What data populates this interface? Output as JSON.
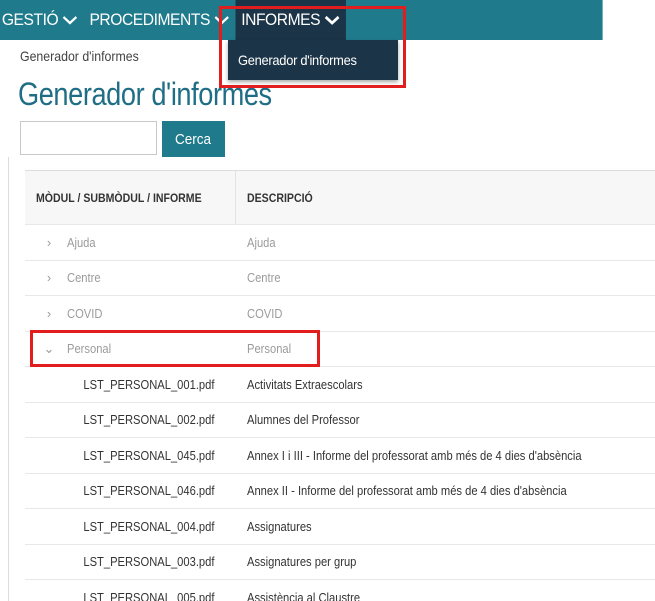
{
  "nav": {
    "items": [
      {
        "label": "GESTIÓ"
      },
      {
        "label": "PROCEDIMENTS"
      },
      {
        "label": "INFORMES"
      }
    ],
    "dropdown": {
      "item": "Generador d'informes"
    }
  },
  "breadcrumb": "Generador d'informes",
  "page_title": "Generador d'informes",
  "search": {
    "value": "",
    "button_label": "Cerca"
  },
  "table": {
    "headers": [
      "MÒDUL / SUBMÒDUL / INFORME",
      "DESCRIPCIÓ"
    ],
    "modules": [
      {
        "name": "Ajuda",
        "description": "Ajuda",
        "arrow": "›"
      },
      {
        "name": "Centre",
        "description": "Centre",
        "arrow": "›"
      },
      {
        "name": "COVID",
        "description": "COVID",
        "arrow": "›"
      },
      {
        "name": "Personal",
        "description": "Personal",
        "arrow": "⌄"
      }
    ],
    "files": [
      {
        "name": "LST_PERSONAL_001.pdf",
        "description": "Activitats Extraescolars"
      },
      {
        "name": "LST_PERSONAL_002.pdf",
        "description": "Alumnes del Professor"
      },
      {
        "name": "LST_PERSONAL_045.pdf",
        "description": "Annex I i III - Informe del professorat amb més de 4 dies d'absència"
      },
      {
        "name": "LST_PERSONAL_046.pdf",
        "description": "Annex II - Informe del professorat amb més de 4 dies d'absència"
      },
      {
        "name": "LST_PERSONAL_004.pdf",
        "description": "Assignatures"
      },
      {
        "name": "LST_PERSONAL_003.pdf",
        "description": "Assignatures per grup"
      },
      {
        "name": "LST_PERSONAL_005.pdf",
        "description": "Assistència al Claustre"
      }
    ]
  },
  "colors": {
    "topbar": "#1f7a8c",
    "active_menu": "#1b3447",
    "title": "#1f6e86",
    "highlight": "#e11d1d"
  },
  "icons": {
    "menu_chevron": "chevron-down-icon",
    "collapsed": "chevron-right-icon",
    "expanded": "chevron-down-icon"
  }
}
